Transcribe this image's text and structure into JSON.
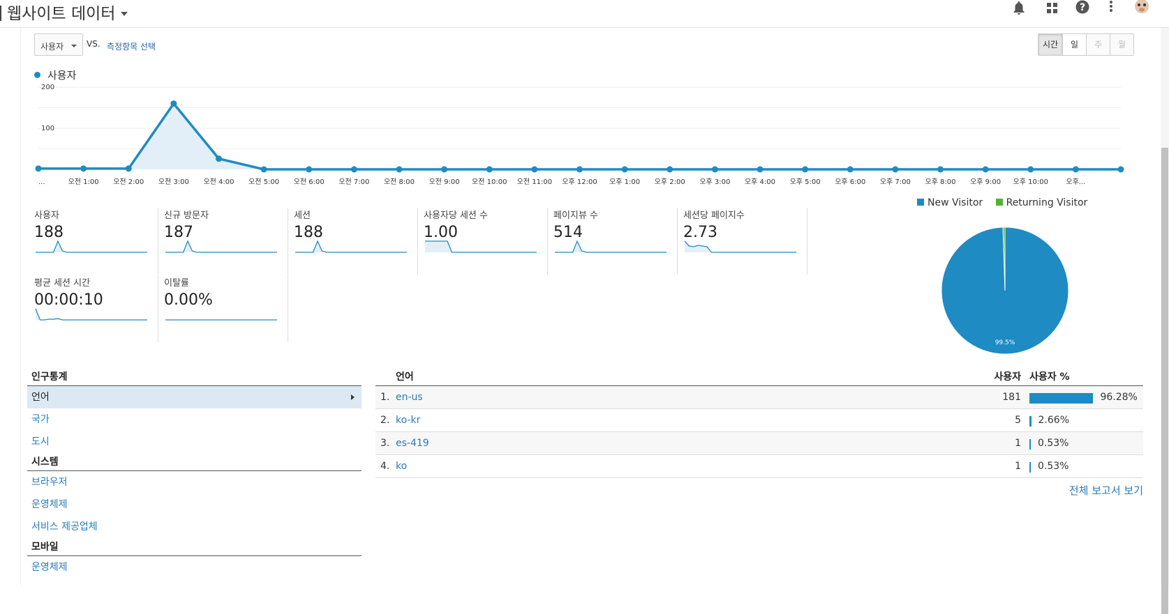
{
  "header": {
    "title": "웹사이트 데이터"
  },
  "controls": {
    "metric_select": "사용자",
    "vs": "VS.",
    "pick_metric": "측정항목 선택",
    "periods": [
      {
        "label": "시간",
        "state": "active"
      },
      {
        "label": "일",
        "state": "normal"
      },
      {
        "label": "주",
        "state": "disabled"
      },
      {
        "label": "월",
        "state": "disabled"
      }
    ]
  },
  "chart_data": {
    "type": "area",
    "series": [
      {
        "name": "사용자",
        "values": [
          2,
          2,
          2,
          160,
          26,
          0,
          0,
          0,
          0,
          0,
          0,
          0,
          0,
          0,
          0,
          0,
          0,
          0,
          0,
          0,
          0,
          0,
          0,
          0,
          0
        ]
      }
    ],
    "x": [
      "...",
      "오전 1:00",
      "오전 2:00",
      "오전 3:00",
      "오전 4:00",
      "오전 5:00",
      "오전 6:00",
      "오전 7:00",
      "오전 8:00",
      "오전 9:00",
      "오전 10:00",
      "오전 11:00",
      "오후 12:00",
      "오후 1:00",
      "오후 2:00",
      "오후 3:00",
      "오후 4:00",
      "오후 5:00",
      "오후 6:00",
      "오후 7:00",
      "오후 8:00",
      "오후 9:00",
      "오후 10:00",
      "오후..."
    ],
    "yticks": [
      "200",
      "100"
    ],
    "ylim": [
      0,
      200
    ],
    "color": "#1e8bc3",
    "grid": true
  },
  "metrics": [
    {
      "label": "사용자",
      "value": "188",
      "spark": [
        0,
        0,
        0,
        0,
        0,
        16,
        2,
        0,
        0,
        0,
        0,
        0,
        0,
        0,
        0,
        0,
        0,
        0,
        0,
        0,
        0,
        0,
        0,
        0,
        0,
        0
      ]
    },
    {
      "label": "신규 방문자",
      "value": "187",
      "spark": [
        0,
        0,
        0,
        0,
        0,
        16,
        2,
        0,
        0,
        0,
        0,
        0,
        0,
        0,
        0,
        0,
        0,
        0,
        0,
        0,
        0,
        0,
        0,
        0,
        0,
        0
      ]
    },
    {
      "label": "세션",
      "value": "188",
      "spark": [
        0,
        0,
        0,
        0,
        0,
        16,
        2,
        0,
        0,
        0,
        0,
        0,
        0,
        0,
        0,
        0,
        0,
        0,
        0,
        0,
        0,
        0,
        0,
        0,
        0,
        0
      ]
    },
    {
      "label": "사용자당 세션 수",
      "value": "1.00",
      "spark": [
        16,
        16,
        16,
        16,
        16,
        16,
        0,
        0,
        0,
        0,
        0,
        0,
        0,
        0,
        0,
        0,
        0,
        0,
        0,
        0,
        0,
        0,
        0,
        0,
        0,
        0
      ]
    },
    {
      "label": "페이지뷰 수",
      "value": "514",
      "spark": [
        0,
        0,
        0,
        0,
        0,
        16,
        2,
        0,
        0,
        0,
        0,
        0,
        0,
        0,
        0,
        0,
        0,
        0,
        0,
        0,
        0,
        0,
        0,
        0,
        0,
        0
      ]
    },
    {
      "label": "세션당 페이지수",
      "value": "2.73",
      "spark": [
        16,
        9,
        8,
        10,
        9,
        8,
        0,
        0,
        0,
        0,
        0,
        0,
        0,
        0,
        0,
        0,
        0,
        0,
        0,
        0,
        0,
        0,
        0,
        0,
        0,
        0
      ]
    },
    {
      "label": "평균 세션 시간",
      "value": "00:00:10",
      "spark": [
        16,
        0,
        0,
        1,
        1,
        2,
        0,
        0,
        0,
        0,
        0,
        0,
        0,
        0,
        0,
        0,
        0,
        0,
        0,
        0,
        0,
        0,
        0,
        0,
        0,
        0
      ]
    },
    {
      "label": "이탈률",
      "value": "0.00%",
      "spark": [
        0,
        0,
        0,
        0,
        0,
        0,
        0,
        0,
        0,
        0,
        0,
        0,
        0,
        0,
        0,
        0,
        0,
        0,
        0,
        0,
        0,
        0,
        0,
        0,
        0,
        0
      ]
    }
  ],
  "pie": {
    "legend": [
      {
        "label": "New Visitor",
        "color": "#1e8bc3"
      },
      {
        "label": "Returning Visitor",
        "color": "#50b432"
      }
    ],
    "slices": [
      {
        "value": 99.5,
        "color": "#1e8bc3"
      },
      {
        "value": 0.5,
        "color": "#50b432"
      }
    ],
    "label": "99.5%"
  },
  "leftnav": {
    "sections": [
      {
        "header": "인구통계",
        "items": [
          {
            "label": "언어",
            "active": true
          },
          {
            "label": "국가"
          },
          {
            "label": "도시"
          }
        ]
      },
      {
        "header": "시스템",
        "items": [
          {
            "label": "브라우저"
          },
          {
            "label": "운영체제"
          },
          {
            "label": "서비스 제공업체"
          }
        ]
      },
      {
        "header": "모바일",
        "items": [
          {
            "label": "운영체제"
          }
        ]
      }
    ]
  },
  "language_table": {
    "headers": {
      "dimension": "언어",
      "users": "사용자",
      "pct": "사용자 %"
    },
    "rows": [
      {
        "rank": "1.",
        "name": "en-us",
        "users": "181",
        "pct": "96.28%",
        "share": 96.28
      },
      {
        "rank": "2.",
        "name": "ko-kr",
        "users": "5",
        "pct": "2.66%",
        "share": 2.66
      },
      {
        "rank": "3.",
        "name": "es-419",
        "users": "1",
        "pct": "0.53%",
        "share": 0.53
      },
      {
        "rank": "4.",
        "name": "ko",
        "users": "1",
        "pct": "0.53%",
        "share": 0.53
      }
    ],
    "full_report": "전체 보고서 보기"
  }
}
